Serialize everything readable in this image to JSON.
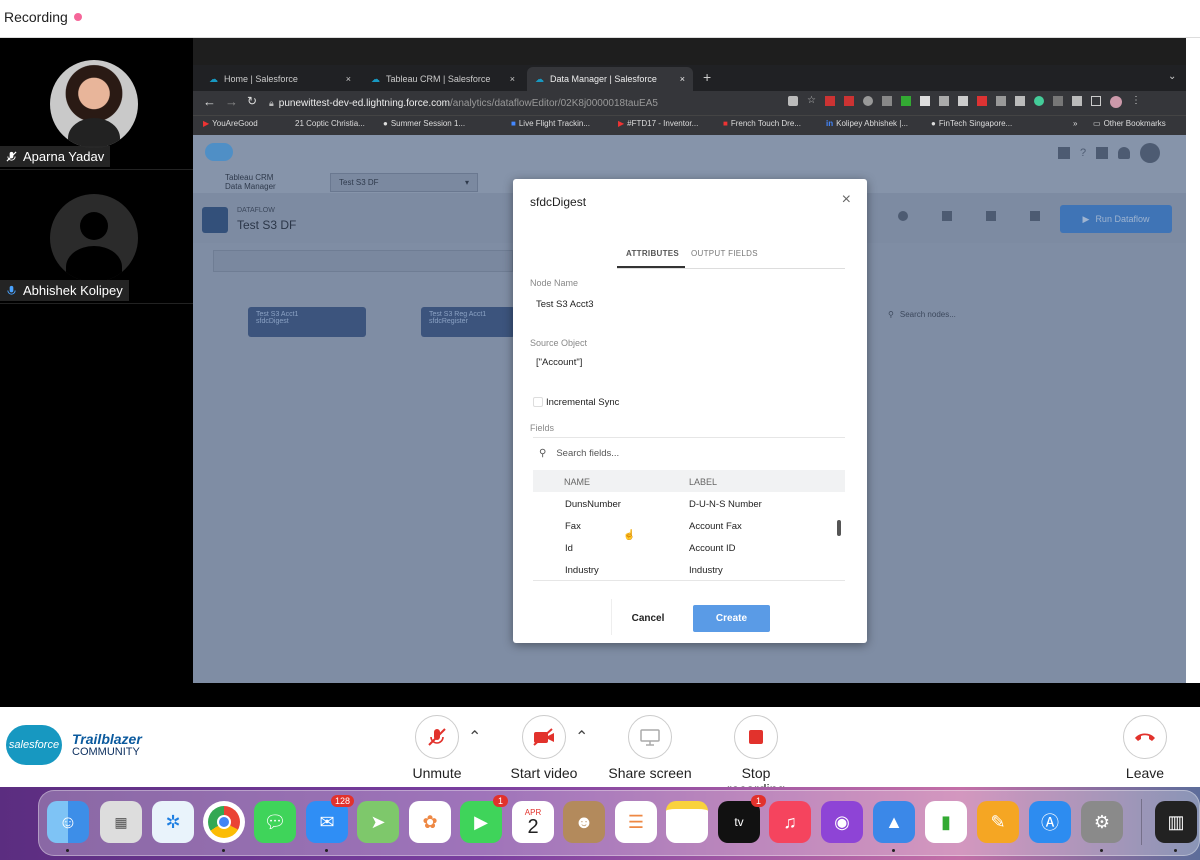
{
  "zoom": {
    "recording_label": "Recording",
    "participants": [
      {
        "name": "Aparna Yadav"
      },
      {
        "name": "Abhishek Kolipey"
      }
    ],
    "controls": [
      {
        "label": "Unmute"
      },
      {
        "label": "Start video"
      },
      {
        "label": "Share screen"
      },
      {
        "label": "Stop recording"
      },
      {
        "label": "Leave"
      }
    ],
    "community_logo": {
      "brand": "salesforce",
      "line1": "Trailblazer",
      "line2": "COMMUNITY"
    }
  },
  "browser": {
    "tabs": [
      {
        "label": "Home | Salesforce"
      },
      {
        "label": "Tableau CRM | Salesforce"
      },
      {
        "label": "Data Manager | Salesforce"
      }
    ],
    "url_host": "punewittest-dev-ed.lightning.force.com",
    "url_path": "/analytics/dataflowEditor/02K8j0000018tauEA5",
    "bookmarks": [
      "YouAreGood",
      "21 Coptic Christia...",
      "Summer Session 1...",
      "Live Flight Trackin...",
      "#FTD17 - Inventor...",
      "French Touch Dre...",
      "Kolipey Abhishek |...",
      "FinTech Singapore..."
    ],
    "bookmarks_more": "»",
    "other_bookmarks": "Other Bookmarks"
  },
  "salesforce": {
    "app_line1": "Tableau CRM",
    "app_line2": "Data Manager",
    "dataflow_select": "Test S3 DF",
    "dataflow_caption": "DATAFLOW",
    "dataflow_title": "Test S3 DF",
    "run_button": "Run Dataflow",
    "nodes": [
      {
        "line1": "Test S3 Acct1",
        "line2": "sfdcDigest"
      },
      {
        "line1": "Test S3 Reg Acct1",
        "line2": "sfdcRegister"
      }
    ],
    "search_nodes_placeholder": "Search nodes..."
  },
  "modal": {
    "title": "sfdcDigest",
    "close_icon": "×",
    "tabs": [
      {
        "label": "ATTRIBUTES",
        "active": true
      },
      {
        "label": "OUTPUT FIELDS",
        "active": false
      }
    ],
    "node_name_label": "Node Name",
    "node_name_value": "Test S3 Acct3",
    "source_object_label": "Source Object",
    "source_object_value": "[\"Account\"]",
    "incremental_sync_label": "Incremental Sync",
    "fields_label": "Fields",
    "search_fields_placeholder": "Search fields...",
    "table": {
      "headers": [
        "NAME",
        "LABEL"
      ],
      "rows": [
        [
          "DunsNumber",
          "D-U-N-S Number"
        ],
        [
          "Fax",
          "Account Fax"
        ],
        [
          "Id",
          "Account ID"
        ],
        [
          "Industry",
          "Industry"
        ]
      ]
    },
    "cancel_label": "Cancel",
    "create_label": "Create"
  },
  "dock": {
    "mail_badge": "128",
    "facetime_badge": "1",
    "tv_badge": "1",
    "calendar_month": "APR",
    "calendar_day": "2",
    "tv_label": "tv"
  },
  "colors": {
    "accent": "#5a9be6",
    "salesforce_blue": "#1798c1",
    "leave_red": "#e2322c",
    "stop_red": "#e2322c"
  }
}
